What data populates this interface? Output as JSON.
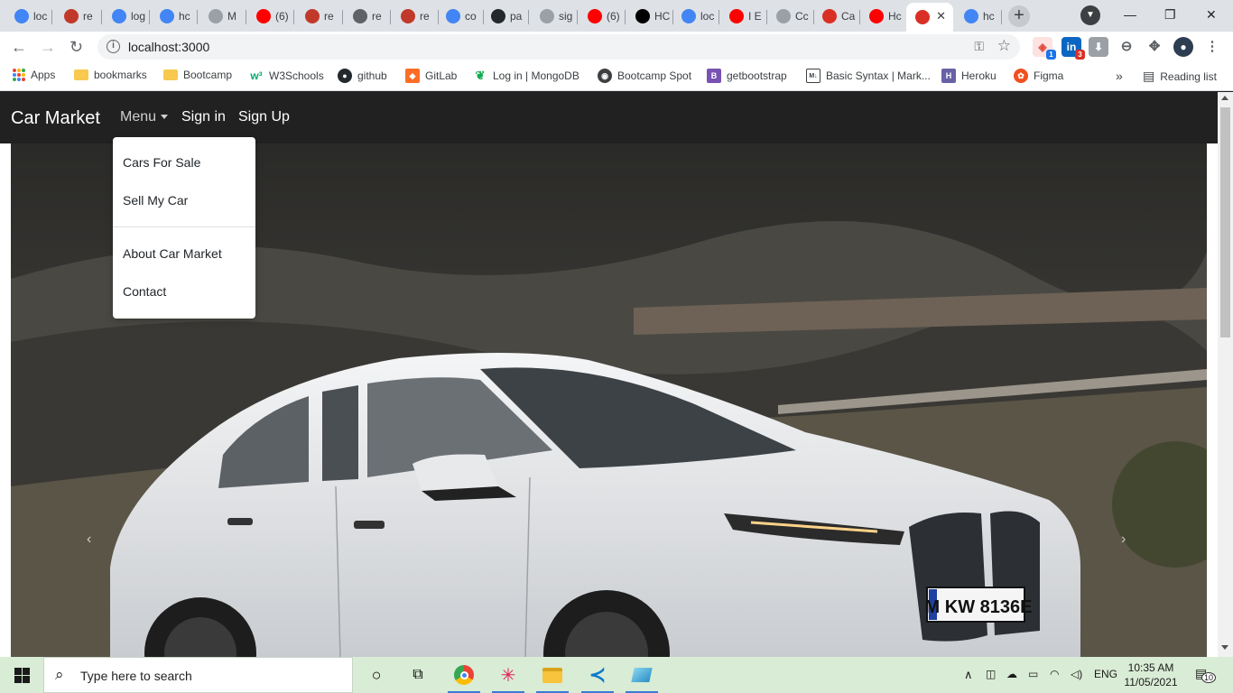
{
  "browser": {
    "tabs": [
      {
        "label": "loc",
        "favicon": "google-icon",
        "color": "#4285f4"
      },
      {
        "label": "re",
        "favicon": "notion-red-icon",
        "color": "#c0392b"
      },
      {
        "label": "log",
        "favicon": "google-icon",
        "color": "#4285f4"
      },
      {
        "label": "hc",
        "favicon": "google-icon",
        "color": "#4285f4"
      },
      {
        "label": "M",
        "favicon": "apple-icon",
        "color": "#9aa0a6"
      },
      {
        "label": "(6)",
        "favicon": "youtube-icon",
        "color": "#ff0000"
      },
      {
        "label": "re",
        "favicon": "notion-red-icon",
        "color": "#c0392b"
      },
      {
        "label": "re",
        "favicon": "globe-icon",
        "color": "#5f6368"
      },
      {
        "label": "re",
        "favicon": "notion-red-icon",
        "color": "#c0392b"
      },
      {
        "label": "co",
        "favicon": "google-icon",
        "color": "#4285f4"
      },
      {
        "label": "pa",
        "favicon": "github-icon",
        "color": "#24292e"
      },
      {
        "label": "sig",
        "favicon": "apple-icon",
        "color": "#9aa0a6"
      },
      {
        "label": "(6)",
        "favicon": "youtube-icon",
        "color": "#ff0000"
      },
      {
        "label": "HC",
        "favicon": "dev-icon",
        "color": "#000000"
      },
      {
        "label": "loc",
        "favicon": "google-icon",
        "color": "#4285f4"
      },
      {
        "label": "I E",
        "favicon": "youtube-icon",
        "color": "#ff0000"
      },
      {
        "label": "Cc",
        "favicon": "apple-icon",
        "color": "#9aa0a6"
      },
      {
        "label": "Ca",
        "favicon": "car-icon",
        "color": "#d93025"
      },
      {
        "label": "Hc",
        "favicon": "youtube-icon",
        "color": "#ff0000"
      },
      {
        "label": "",
        "favicon": "car-icon",
        "color": "#d93025"
      },
      {
        "label": "hc",
        "favicon": "google-icon",
        "color": "#4285f4"
      }
    ],
    "active_tab_index": 19,
    "url": "localhost:3000",
    "extension_badges": {
      "first": "1",
      "linkedin": "3"
    },
    "bookmarks": [
      {
        "label": "Apps",
        "icon": "apps-grid-icon"
      },
      {
        "label": "bookmarks",
        "icon": "folder-icon"
      },
      {
        "label": "Bootcamp",
        "icon": "folder-icon"
      },
      {
        "label": "W3Schools",
        "icon": "w3schools-icon"
      },
      {
        "label": "github",
        "icon": "github-icon"
      },
      {
        "label": "GitLab",
        "icon": "gitlab-icon"
      },
      {
        "label": "Log in | MongoDB",
        "icon": "mongodb-icon"
      },
      {
        "label": "Bootcamp Spot",
        "icon": "bootcamp-spot-icon"
      },
      {
        "label": "getbootstrap",
        "icon": "bootstrap-icon"
      },
      {
        "label": "Basic Syntax | Mark...",
        "icon": "markdown-icon"
      },
      {
        "label": "Heroku",
        "icon": "heroku-icon"
      },
      {
        "label": "Figma",
        "icon": "figma-icon"
      }
    ],
    "overflow_label": "»",
    "reading_list_label": "Reading list"
  },
  "page": {
    "brand": "Car Market",
    "nav": {
      "menu_label": "Menu",
      "signin_label": "Sign in",
      "signup_label": "Sign Up"
    },
    "dropdown": {
      "items": [
        "Cars For Sale",
        "Sell My Car",
        "About Car Market",
        "Contact"
      ]
    },
    "carousel": {
      "prev_symbol": "‹",
      "next_symbol": "›",
      "image_alt": "White BMW iX SUV",
      "plate_text": "M KW 8136E"
    }
  },
  "taskbar": {
    "search_placeholder": "Type here to search",
    "language": "ENG",
    "time": "10:35 AM",
    "date": "11/05/2021",
    "notification_count": "10"
  }
}
